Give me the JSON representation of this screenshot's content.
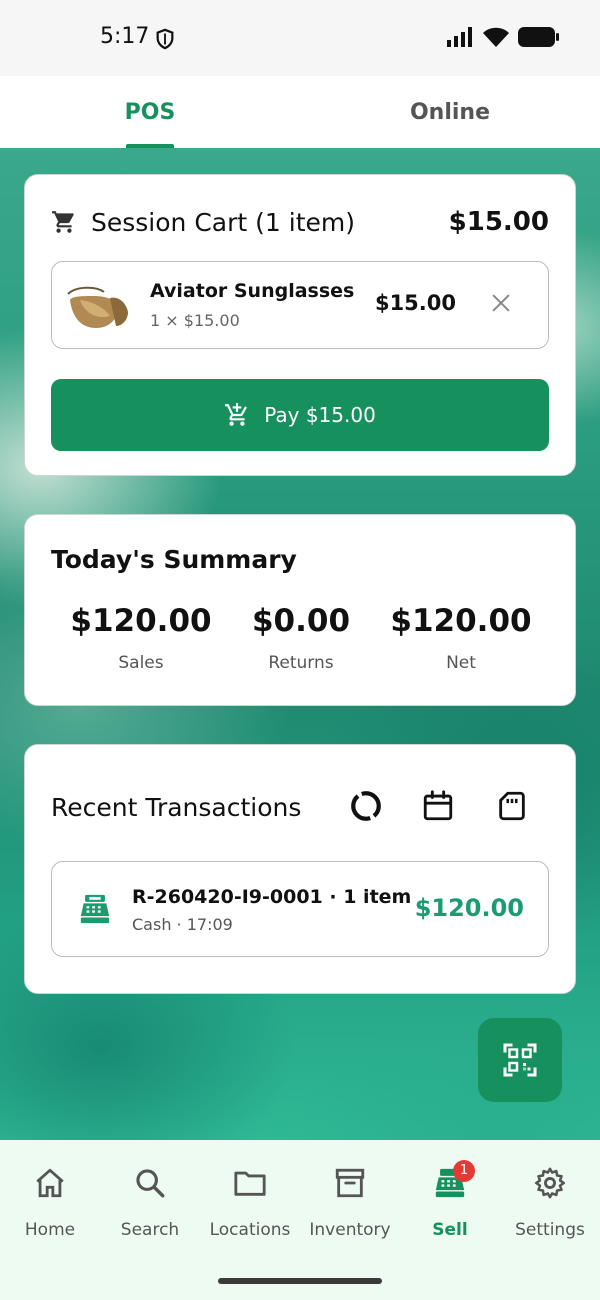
{
  "status_bar": {
    "time": "5:17"
  },
  "tabs": [
    {
      "label": "POS",
      "active": true
    },
    {
      "label": "Online",
      "active": false
    }
  ],
  "cart": {
    "title": "Session Cart (1 item)",
    "total": "$15.00",
    "items": [
      {
        "name": "Aviator Sunglasses",
        "sub": "1 × $15.00",
        "price": "$15.00"
      }
    ],
    "pay_label": "Pay $15.00"
  },
  "summary": {
    "title": "Today's Summary",
    "stats": [
      {
        "value": "$120.00",
        "label": "Sales"
      },
      {
        "value": "$0.00",
        "label": "Returns"
      },
      {
        "value": "$120.00",
        "label": "Net"
      }
    ]
  },
  "transactions": {
    "title": "Recent Transactions",
    "items": [
      {
        "id": "R-260420-I9-0001 · 1 item",
        "sub": "Cash · 17:09",
        "amount": "$120.00"
      }
    ]
  },
  "bottom_nav": {
    "items": [
      {
        "label": "Home",
        "icon": "home-icon"
      },
      {
        "label": "Search",
        "icon": "search-icon"
      },
      {
        "label": "Locations",
        "icon": "folder-icon"
      },
      {
        "label": "Inventory",
        "icon": "archive-icon"
      },
      {
        "label": "Sell",
        "icon": "cash-register-icon",
        "active": true,
        "badge": "1"
      },
      {
        "label": "Settings",
        "icon": "gear-icon"
      }
    ]
  },
  "colors": {
    "accent": "#16915e",
    "amount_green": "#1c9b6e",
    "badge_red": "#e53935"
  }
}
